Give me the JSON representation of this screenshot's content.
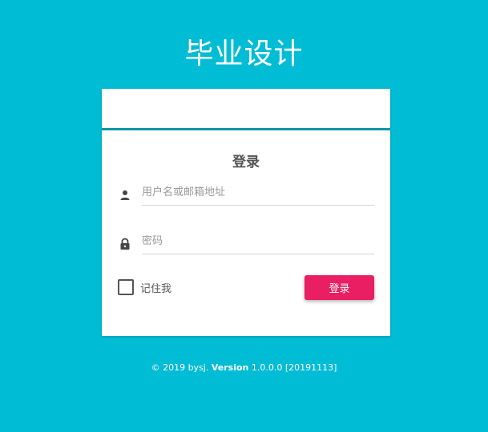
{
  "app": {
    "title": "毕业设计"
  },
  "login": {
    "heading": "登录",
    "username_placeholder": "用户名或邮箱地址",
    "username_value": "",
    "password_placeholder": "密码",
    "password_value": "",
    "remember_label": "记住我",
    "remember_checked": false,
    "submit_label": "登录",
    "username_icon": "person-icon",
    "password_icon": "lock-icon"
  },
  "footer": {
    "copyright": "© 2019 bysj.",
    "version_label": "Version",
    "version_value": "1.0.0.0 [20191113]"
  },
  "colors": {
    "background": "#00BCD4",
    "header_border": "#0097A7",
    "button": "#E91E63",
    "card": "#FFFFFF"
  }
}
